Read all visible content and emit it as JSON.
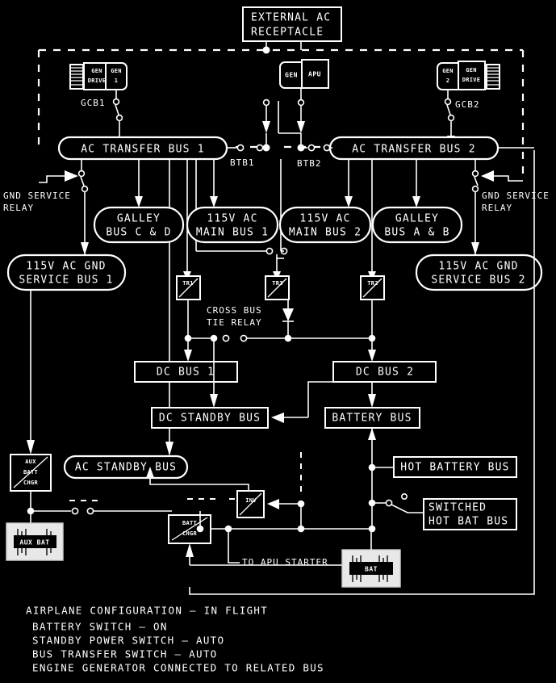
{
  "diagram": {
    "title_block": {
      "lines": [
        "AIRPLANE CONFIGURATION — IN FLIGHT",
        "BATTERY SWITCH — ON",
        "STANDBY POWER SWITCH — AUTO",
        "BUS TRANSFER SWITCH — AUTO",
        "ENGINE GENERATOR CONNECTED TO RELATED BUS"
      ]
    },
    "colors": {
      "background": "#000000",
      "line": "#ffffff",
      "battery_fill": "#e8e8e8"
    },
    "nodes": {
      "external_ac": {
        "line1": "EXTERNAL AC",
        "line2": "RECEPTACLE"
      },
      "gen_drive_1": "GEN\nDRIVE",
      "gen_drive_1_l1": "GEN",
      "gen_drive_1_l2": "DRIVE",
      "gen_1_l1": "GEN",
      "gen_1_l2": "1",
      "gcb1": "GCB1",
      "gen_apu_l1": "GEN",
      "apu": "APU",
      "gen_2_l1": "GEN",
      "gen_2_l2": "2",
      "gen_drive_2_l1": "GEN",
      "gen_drive_2_l2": "DRIVE",
      "gcb2": "GCB2",
      "ac_transfer_bus_1": "AC TRANSFER BUS 1",
      "ac_transfer_bus_2": "AC TRANSFER BUS 2",
      "btb1": "BTB1",
      "btb2": "BTB2",
      "gnd_service_relay_left_l1": "GND SERVICE",
      "gnd_service_relay_left_l2": "RELAY",
      "gnd_service_relay_right_l1": "GND SERVICE",
      "gnd_service_relay_right_l2": "RELAY",
      "galley_cd_l1": "GALLEY",
      "galley_cd_l2": "BUS C & D",
      "galley_ab_l1": "GALLEY",
      "galley_ab_l2": "BUS A & B",
      "main_bus_1_l1": "115V AC",
      "main_bus_1_l2": "MAIN BUS 1",
      "main_bus_2_l1": "115V AC",
      "main_bus_2_l2": "MAIN BUS 2",
      "gnd_service_bus_1_l1": "115V AC GND",
      "gnd_service_bus_1_l2": "SERVICE BUS 1",
      "gnd_service_bus_2_l1": "115V AC GND",
      "gnd_service_bus_2_l2": "SERVICE BUS 2",
      "tr1": "TR1",
      "tr2": "TR2",
      "tr3": "TR3",
      "cross_bus_tie_relay_l1": "CROSS BUS",
      "cross_bus_tie_relay_l2": "TIE RELAY",
      "dc_bus_1": "DC BUS 1",
      "dc_bus_2": "DC BUS 2",
      "dc_standby_bus": "DC STANDBY BUS",
      "battery_bus": "BATTERY BUS",
      "ac_standby_bus": "AC STANDBY BUS",
      "hot_battery_bus": "HOT BATTERY BUS",
      "switched_hot_bat_bus_l1": "SWITCHED",
      "switched_hot_bat_bus_l2": "HOT BAT BUS",
      "aux_batt_chgr_l1": "AUX",
      "aux_batt_chgr_l2": "BATT",
      "aux_batt_chgr_l3": "CHGR",
      "aux_bat": "AUX BAT",
      "batt_chgr_l1": "BATT",
      "batt_chgr_l2": "CHGR",
      "bat": "BAT",
      "inv": "INV",
      "to_apu_starter": "TO APU STARTER"
    }
  }
}
